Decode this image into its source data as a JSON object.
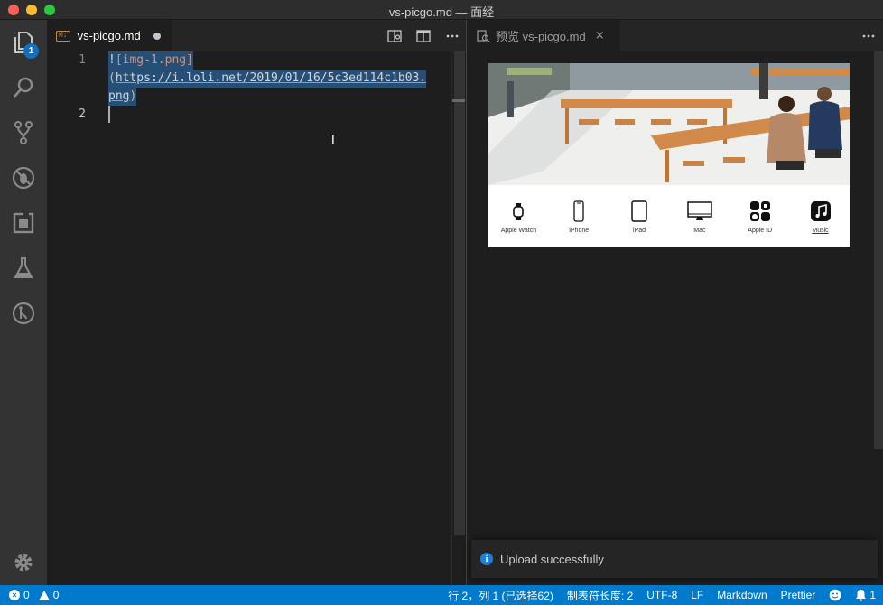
{
  "window": {
    "title": "vs-picgo.md — 面经"
  },
  "activity_bar": {
    "explorer_badge": "1"
  },
  "editor": {
    "tab_label": "vs-picgo.md",
    "file_type_badge": "M↓",
    "line_numbers": [
      "1",
      "2"
    ],
    "line1a_bang": "!",
    "line1a_alt": "[img-1.png]",
    "line1b_open": "(",
    "line1b_url": "https://i.loli.net/2019/01/16/5c3ed114c1b03.",
    "line1c_url": "png",
    "line1c_close": ")"
  },
  "preview": {
    "tab_label": "预览 vs-picgo.md",
    "close_glyph": "×",
    "nav_items": [
      "Apple Watch",
      "iPhone",
      "iPad",
      "Mac",
      "Apple ID",
      "Music"
    ]
  },
  "notification": {
    "message": "Upload successfully"
  },
  "statusbar": {
    "errors": "0",
    "warnings": "0",
    "position": "行 2，列 1 (已选择62)",
    "tab_size": "制表符长度: 2",
    "encoding": "UTF-8",
    "eol": "LF",
    "language": "Markdown",
    "formatter": "Prettier",
    "notifications_count": "1"
  },
  "colors": {
    "accent": "#007acc",
    "selection": "#264f78",
    "string": "#ce9178",
    "paren": "#d7ba7d"
  }
}
